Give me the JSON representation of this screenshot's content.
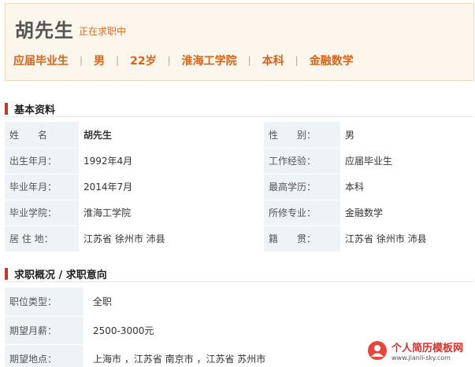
{
  "header": {
    "name": "胡先生",
    "status": "正在求职中",
    "tags": [
      "应届毕业生",
      "男",
      "22岁",
      "淮海工学院",
      "本科",
      "金融数学"
    ]
  },
  "basic": {
    "title": "基本资料",
    "rows": [
      {
        "l1": "姓　　名",
        "v1": "胡先生",
        "l2": "性　　别：",
        "v2": "男"
      },
      {
        "l1": "出生年月：",
        "v1": "1992年4月",
        "l2": "工作经验：",
        "v2": "应届毕业生"
      },
      {
        "l1": "毕业年月：",
        "v1": "2014年7月",
        "l2": "最高学历：",
        "v2": "本科"
      },
      {
        "l1": "毕业学院：",
        "v1": "淮海工学院",
        "l2": "所修专业：",
        "v2": "金融数学"
      },
      {
        "l1": "居 住 地：",
        "v1": "江苏省 徐州市 沛县",
        "l2": "籍　　贯：",
        "v2": "江苏省 徐州市 沛县"
      }
    ]
  },
  "intent": {
    "title": "求职概况 / 求职意向",
    "rows": [
      {
        "l": "职位类型：",
        "v": "全职"
      },
      {
        "l": "期望月薪：",
        "v": "2500-3000元"
      },
      {
        "l": "期望地点：",
        "v": "上海市 ，江苏省 南京市 ，江苏省 苏州市"
      }
    ]
  },
  "watermark": {
    "title": "个人简历模板网",
    "url": "www.jianli-sky.com"
  }
}
